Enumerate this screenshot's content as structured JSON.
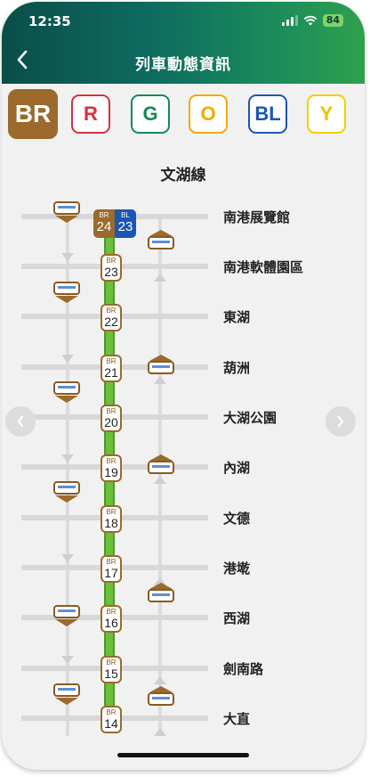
{
  "status": {
    "time": "12:35",
    "battery": "84"
  },
  "header": {
    "title": "列車動態資訊"
  },
  "colors": {
    "br": "#9b6a2c",
    "r": "#d6323c",
    "g": "#138a55",
    "o": "#f2a900",
    "bl": "#1b56b5",
    "y": "#f0d000",
    "track_green": "#6bbf3b"
  },
  "line_tabs": [
    {
      "label": "BR",
      "selected": true
    },
    {
      "label": "R"
    },
    {
      "label": "G"
    },
    {
      "label": "O"
    },
    {
      "label": "BL"
    },
    {
      "label": "Y"
    }
  ],
  "line_name": "文湖線",
  "transfer": {
    "left_line": "BR",
    "left_num": "24",
    "right_line": "BL",
    "right_num": "23"
  },
  "stations": [
    {
      "name": "南港展覽館",
      "line": "BR",
      "num": "24"
    },
    {
      "name": "南港軟體園區",
      "line": "BR",
      "num": "23"
    },
    {
      "name": "東湖",
      "line": "BR",
      "num": "22"
    },
    {
      "name": "葫洲",
      "line": "BR",
      "num": "21"
    },
    {
      "name": "大湖公園",
      "line": "BR",
      "num": "20"
    },
    {
      "name": "內湖",
      "line": "BR",
      "num": "19"
    },
    {
      "name": "文德",
      "line": "BR",
      "num": "18"
    },
    {
      "name": "港墘",
      "line": "BR",
      "num": "17"
    },
    {
      "name": "西湖",
      "line": "BR",
      "num": "16"
    },
    {
      "name": "劍南路",
      "line": "BR",
      "num": "15"
    },
    {
      "name": "大直",
      "line": "BR",
      "num": "14"
    }
  ]
}
